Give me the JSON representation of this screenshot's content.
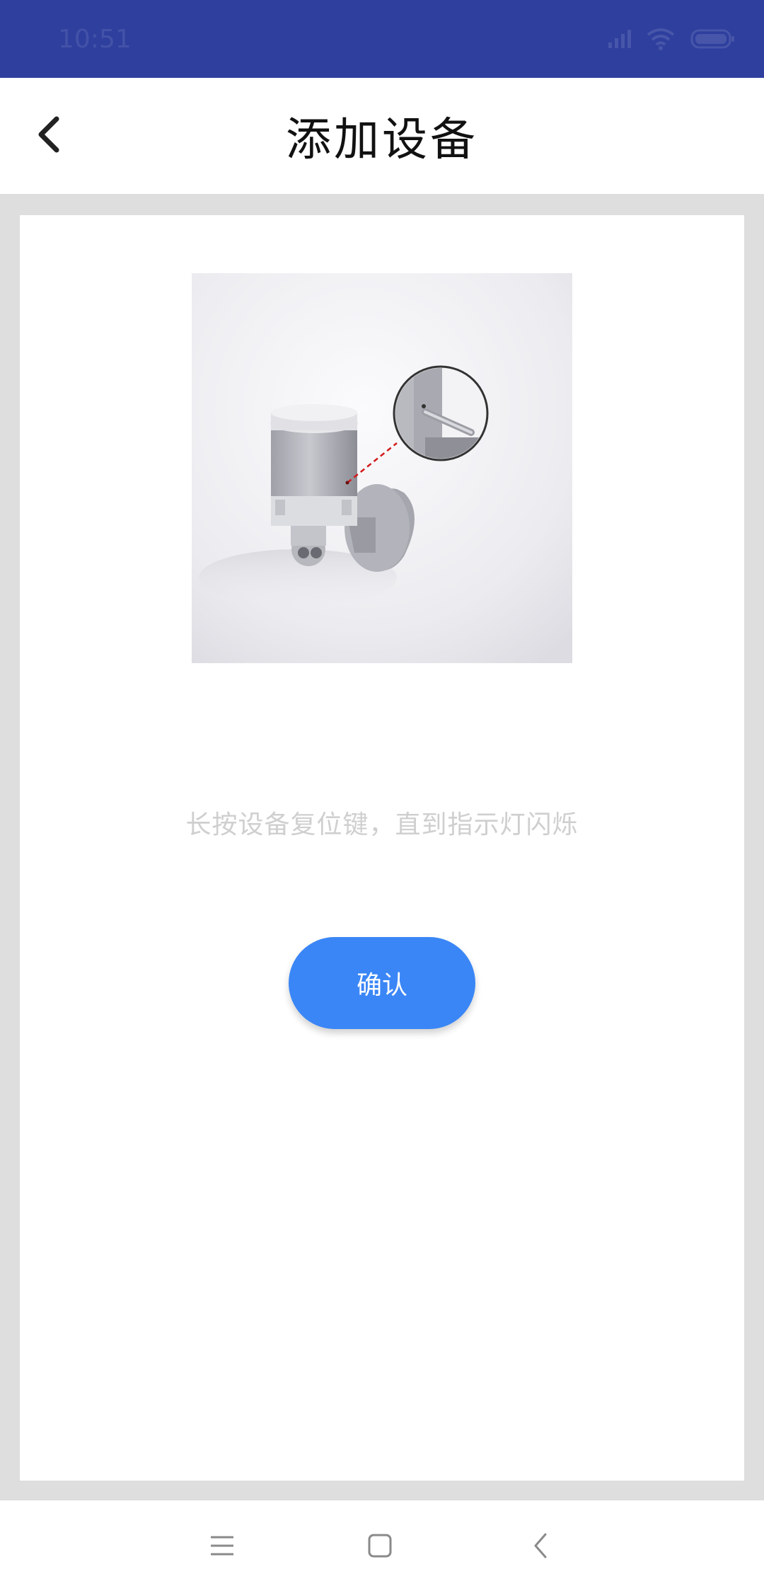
{
  "status_bar": {
    "time": "10:51",
    "background_color": "#2e3f9e",
    "icons": [
      "signal-icon",
      "wifi-icon",
      "battery-icon"
    ]
  },
  "header": {
    "title": "添加设备",
    "back_icon": "chevron-left-icon"
  },
  "main": {
    "image_subject": "motion-sensor-reset-illustration",
    "instruction": "长按设备复位键，直到指示灯闪烁",
    "confirm_label": "确认",
    "accent_color": "#3a86f6"
  },
  "system_nav": {
    "icons": [
      "menu-icon",
      "home-icon",
      "back-icon"
    ]
  }
}
